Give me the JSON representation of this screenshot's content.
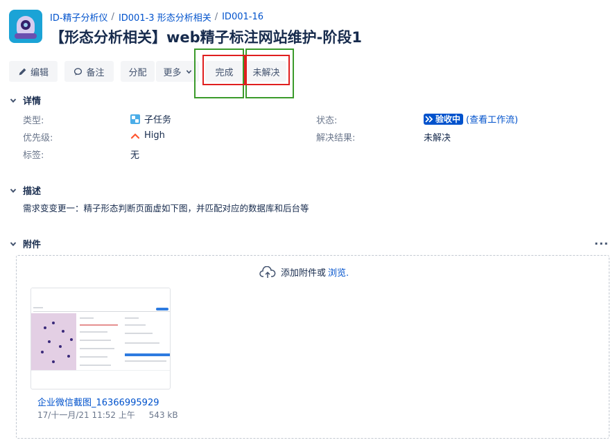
{
  "project": {
    "logo_label": "ID-精子分析仪 project avatar"
  },
  "breadcrumb": [
    {
      "label": "ID-精子分析仪"
    },
    {
      "label": "ID001-3 形态分析相关"
    },
    {
      "label": "ID001-16"
    }
  ],
  "breadcrumb_sep": "/",
  "issue": {
    "title": "【形态分析相关】web精子标注网站维护-阶段1"
  },
  "toolbar": {
    "edit_label": "编辑",
    "comment_label": "备注",
    "assign_label": "分配",
    "more_label": "更多",
    "done_label": "完成",
    "unresolved_label": "未解决"
  },
  "highlights": {
    "red": "#e01e1e",
    "green": "#3a9a2a"
  },
  "details": {
    "heading": "详情",
    "type_label": "类型:",
    "type_value": "子任务",
    "priority_label": "优先级:",
    "priority_value": "High",
    "labels_label": "标签:",
    "labels_value": "无",
    "status_label": "状态:",
    "status_value": "验收中",
    "workflow_link": "(查看工作流)",
    "resolution_label": "解决结果:",
    "resolution_value": "未解决"
  },
  "description": {
    "heading": "描述",
    "text": "需求变变更一：精子形态判断页面虚如下图，并匹配对应的数据库和后台等"
  },
  "attachments": {
    "heading": "附件",
    "more_label": "···",
    "drop_text": "添加附件或",
    "browse_link": "浏览.",
    "file": {
      "name": "企业微信截图_16366995929",
      "date": "17/十一月/21 11:52 上午",
      "size": "543 kB"
    }
  },
  "colors": {
    "link": "#0052cc",
    "status_bg": "#0052cc",
    "priority_icon": "#ff5630",
    "type_icon": "#4bade8"
  }
}
